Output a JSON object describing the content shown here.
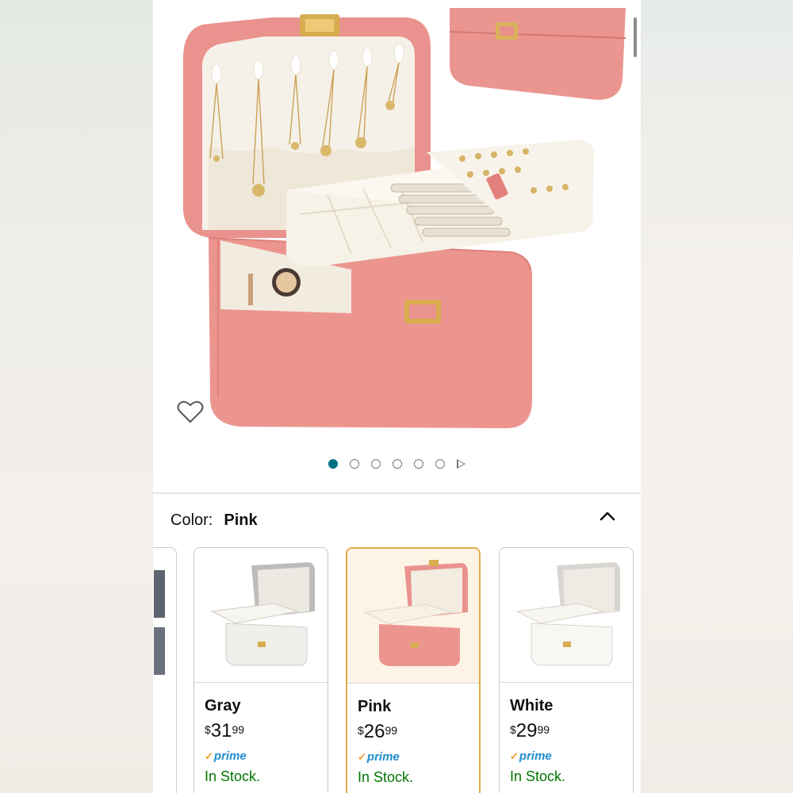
{
  "product": {
    "image_carousel": {
      "total_dots": 6,
      "active_index": 0
    }
  },
  "variation": {
    "label": "Color:",
    "selected_value": "Pink"
  },
  "swatches": [
    {
      "name": "Gray",
      "currency": "$",
      "whole": "31",
      "fraction": "99",
      "prime_label": "prime",
      "stock": "In Stock.",
      "selected": false,
      "color": "#f0eeea"
    },
    {
      "name": "Pink",
      "currency": "$",
      "whole": "26",
      "fraction": "99",
      "prime_label": "prime",
      "stock": "In Stock.",
      "selected": true,
      "color": "#e88f8a"
    },
    {
      "name": "White",
      "currency": "$",
      "whole": "29",
      "fraction": "99",
      "prime_label": "prime",
      "stock": "In Stock.",
      "selected": false,
      "color": "#f7f6f3"
    }
  ],
  "colors": {
    "accent_teal": "#007185",
    "stock_green": "#007600",
    "prime_blue": "#1f8ed1",
    "selected_border": "#e3a94b",
    "box_pink": "#e88f8a"
  },
  "icons": {
    "favorite": "heart-outline-icon",
    "collapse": "chevron-up-icon",
    "carousel_next": "play-triangle-icon"
  }
}
